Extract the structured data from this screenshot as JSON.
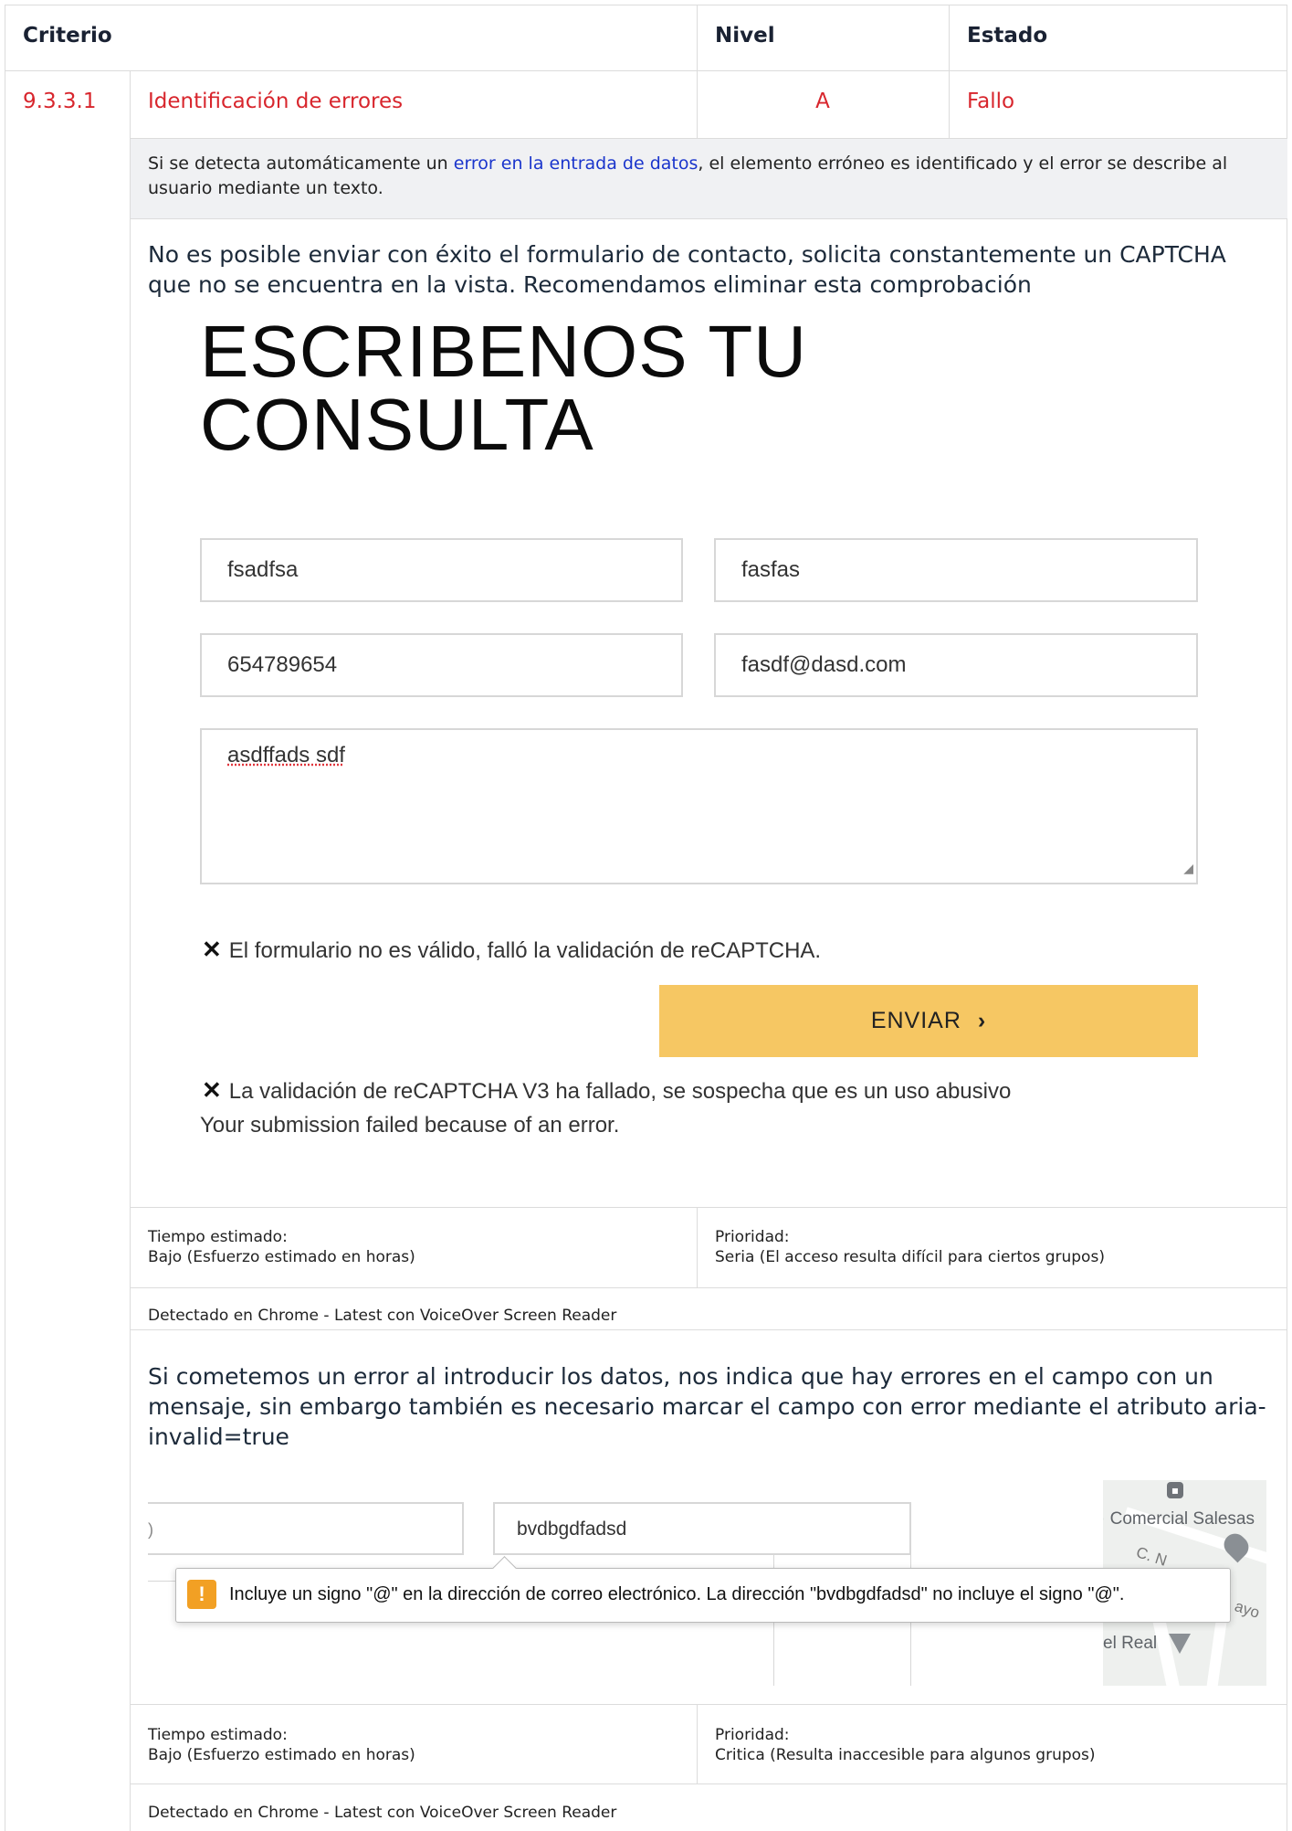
{
  "header": {
    "criterio": "Criterio",
    "nivel": "Nivel",
    "estado": "Estado"
  },
  "row": {
    "id": "9.3.3.1",
    "name": "Identificación de errores",
    "level": "A",
    "status": "Fallo",
    "description_pre": "Si se detecta automáticamente un ",
    "description_link": "error en la entrada de datos",
    "description_post": ", el elemento erróneo es identificado y el error se describe al usuario mediante un texto."
  },
  "issue1": {
    "note": "No es posible enviar con éxito el formulario de contacto, solicita constantemente un CAPTCHA que no se encuentra en la vista. Recomendamos eliminar esta comprobación",
    "form": {
      "title_line1": "ESCRIBENOS TU",
      "title_line2": "CONSULTA",
      "name_value": "fsadfsa",
      "surname_value": "fasfas",
      "phone_value": "654789654",
      "email_value": "fasdf@dasd.com",
      "message_value": "asdffads sdf",
      "error1": "El formulario no es válido, falló la validación de reCAPTCHA.",
      "submit_label": "ENVIAR",
      "error2": "La validación de reCAPTCHA V3 ha fallado, se sospecha que es un uso abusivo",
      "error3": "Your submission failed because of an error."
    },
    "time_label": "Tiempo estimado:",
    "time_value": "Bajo (Esfuerzo estimado en horas)",
    "priority_label": "Prioridad:",
    "priority_value": "Seria (El acceso resulta difícil para ciertos grupos)",
    "detected": "Detectado en Chrome - Latest con VoiceOver Screen Reader"
  },
  "issue2": {
    "note": "Si cometemos un error al introducir los datos, nos indica que hay errores en el campo con un mensaje, sin embargo también es necesario marcar el campo con error mediante el atributo aria-invalid=true",
    "left_field_fragment": ")",
    "email_value": "bvdbgdfadsd",
    "tooltip": "Incluye un signo \"@\" en la dirección de correo electrónico. La dirección \"bvdbgdfadsd\" no incluye el signo \"@\".",
    "map_label1": "Comercial Salesas",
    "map_label2": "C. N",
    "map_label3": "el Real",
    "map_label4": "ayo",
    "time_label": "Tiempo estimado:",
    "time_value": "Bajo (Esfuerzo estimado en horas)",
    "priority_label": "Prioridad:",
    "priority_value": "Critica (Resulta inaccesible para algunos grupos)",
    "detected": "Detectado en Chrome - Latest con VoiceOver Screen Reader"
  },
  "colors": {
    "fail_red": "#d8262d",
    "link_blue": "#1a35cc",
    "button_yellow": "#f6c763",
    "warning_orange": "#f2a024"
  }
}
